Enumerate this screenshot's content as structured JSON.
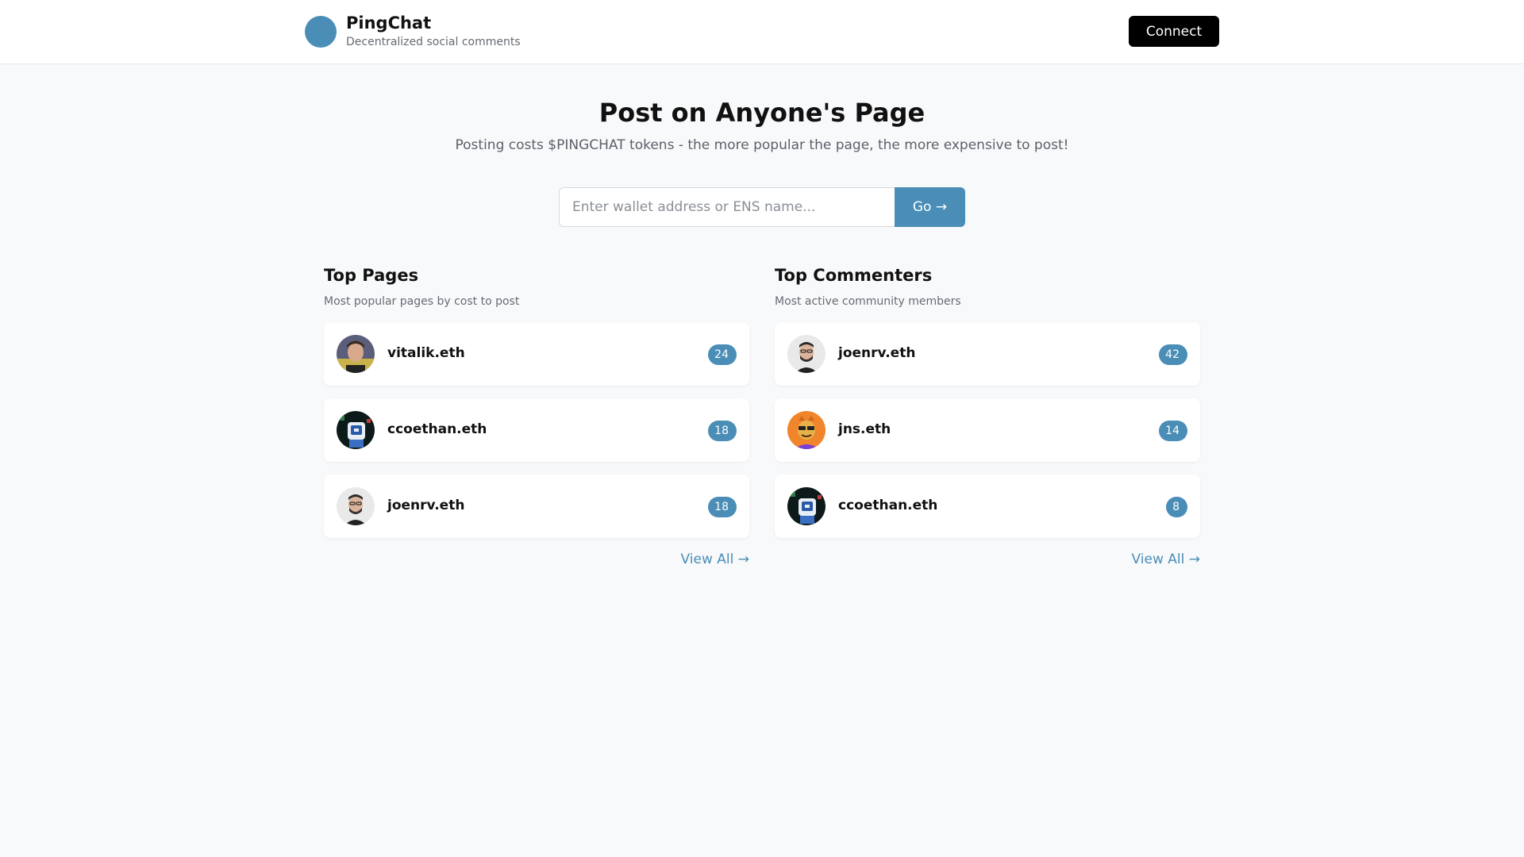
{
  "header": {
    "logo_icon": "",
    "brand_name": "PingChat",
    "brand_tagline": "Decentralized social comments",
    "theme_icon": "",
    "connect_label": "Connect"
  },
  "hero": {
    "title": "Post on Anyone's Page",
    "subtitle": "Posting costs $PINGCHAT tokens - the more popular the page, the more expensive to post!"
  },
  "search": {
    "placeholder": "Enter wallet address or ENS name...",
    "value": "",
    "go_label": "Go →"
  },
  "top_pages": {
    "title": "Top Pages",
    "subtitle": "Most popular pages by cost to post",
    "items": [
      {
        "name": "vitalik.eth",
        "count": "24",
        "icon": "",
        "avatar": "vitalik-avatar"
      },
      {
        "name": "ccoethan.eth",
        "count": "18",
        "icon": "",
        "avatar": "ccoethan-avatar"
      },
      {
        "name": "joenrv.eth",
        "count": "18",
        "icon": "",
        "avatar": "joenrv-avatar"
      }
    ],
    "view_all": "View All →"
  },
  "top_commenters": {
    "title": "Top Commenters",
    "subtitle": "Most active community members",
    "items": [
      {
        "name": "joenrv.eth",
        "count": "42",
        "icon": "",
        "avatar": "joenrv-avatar"
      },
      {
        "name": "jns.eth",
        "count": "14",
        "icon": "",
        "avatar": "jns-avatar"
      },
      {
        "name": "ccoethan.eth",
        "count": "8",
        "icon": "",
        "avatar": "ccoethan-avatar"
      }
    ],
    "view_all": "View All →"
  },
  "colors": {
    "accent": "#4a8db7",
    "background": "#f8f9fb",
    "header_bg": "#ffffff",
    "connect_bg": "#000000"
  }
}
